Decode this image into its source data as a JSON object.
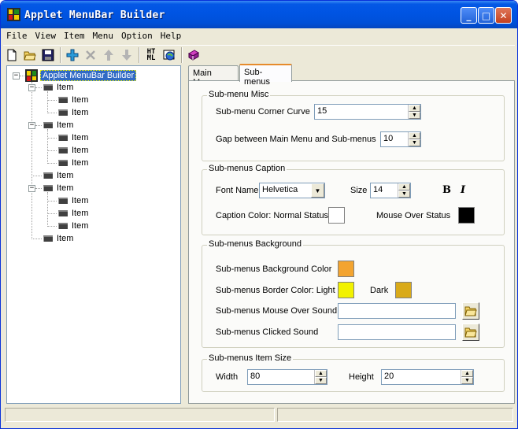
{
  "window": {
    "title": "Applet MenuBar Builder",
    "minimize_glyph": "_",
    "maximize_glyph": "□",
    "close_glyph": "✕"
  },
  "menubar": [
    "File",
    "View",
    "Item",
    "Menu",
    "Option",
    "Help"
  ],
  "toolbar": {
    "icons": [
      "new-icon",
      "open-icon",
      "save-icon",
      "add-icon",
      "delete-icon",
      "move-up-icon",
      "move-down-icon",
      "html-icon",
      "preview-icon",
      "help-book-icon"
    ],
    "html_label_top": "HT",
    "html_label_bottom": "ML"
  },
  "tree": {
    "root": "Applet MenuBar Builder",
    "item_label": "Item"
  },
  "tabs": {
    "main_menu": "Main Menu",
    "sub_menus": "Sub-menus"
  },
  "misc": {
    "title": "Sub-menu Misc",
    "corner_curve_label": "Sub-menu Corner Curve",
    "corner_curve_value": "15",
    "gap_label": "Gap between Main Menu and Sub-menus",
    "gap_value": "10"
  },
  "caption": {
    "title": "Sub-menus Caption",
    "font_name_label": "Font Name",
    "font_name_value": "Helvetica",
    "size_label": "Size",
    "size_value": "14",
    "bold_label": "B",
    "italic_label": "I",
    "normal_color_label": "Caption Color: Normal Status",
    "normal_color": "#ffffff",
    "mouse_over_label": "Mouse Over Status",
    "mouse_over_color": "#000000"
  },
  "background": {
    "title": "Sub-menus Background",
    "bg_color_label": "Sub-menus Background Color",
    "bg_color": "#f3a430",
    "border_color_label": "Sub-menus Border Color:  Light",
    "border_light": "#f2f200",
    "dark_label": "Dark",
    "border_dark": "#d9aa19",
    "mouse_over_sound_label": "Sub-menus Mouse Over Sound",
    "mouse_over_sound_value": "",
    "clicked_sound_label": "Sub-menus Clicked Sound",
    "clicked_sound_value": ""
  },
  "item_size": {
    "title": "Sub-menus Item Size",
    "width_label": "Width",
    "width_value": "80",
    "height_label": "Height",
    "height_value": "20"
  },
  "colors": {
    "titlebar": "#0054e3",
    "window_bg": "#ece9d8",
    "selection": "#316ac5"
  }
}
